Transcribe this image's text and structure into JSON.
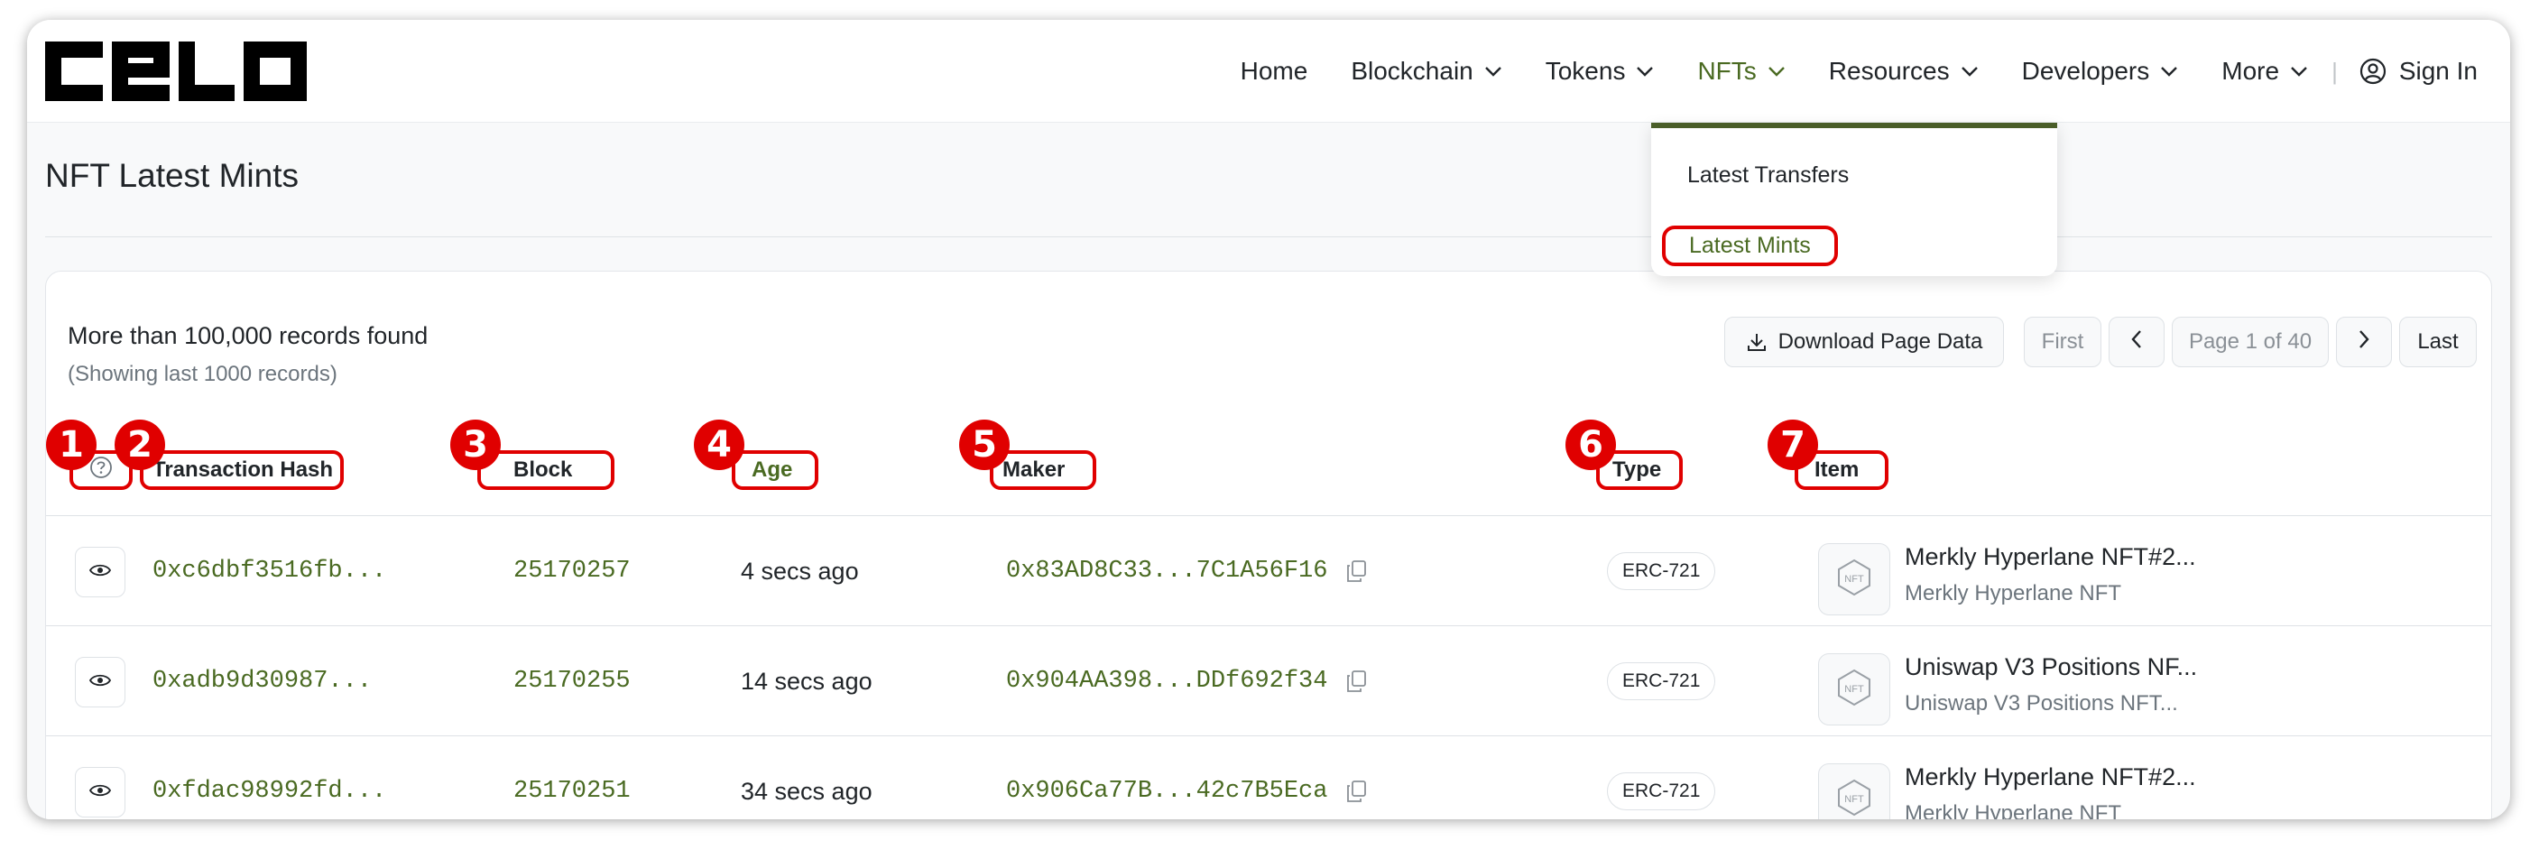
{
  "brand": {
    "logo_text": "CELO"
  },
  "nav": {
    "items": [
      {
        "label": "Home",
        "icon": ""
      },
      {
        "label": "Blockchain",
        "icon": "chevron-down-icon"
      },
      {
        "label": "Tokens",
        "icon": "chevron-down-icon"
      },
      {
        "label": "NFTs",
        "icon": "chevron-down-icon"
      },
      {
        "label": "Resources",
        "icon": "chevron-down-icon"
      },
      {
        "label": "Developers",
        "icon": "chevron-down-icon"
      },
      {
        "label": "More",
        "icon": "chevron-down-icon"
      }
    ],
    "signin": "Sign In"
  },
  "nft_dropdown": {
    "items": [
      "Latest Transfers",
      "Latest Mints"
    ],
    "active": "Latest Mints"
  },
  "page": {
    "title": "NFT Latest Mints"
  },
  "summary": {
    "records": "More than 100,000 records found",
    "sub": "(Showing last 1000 records)"
  },
  "toolbar": {
    "download": "Download Page Data",
    "first": "First",
    "page": "Page 1 of 40",
    "last": "Last"
  },
  "table": {
    "columns": [
      "Transaction Hash",
      "Block",
      "Age",
      "Maker",
      "Type",
      "Item"
    ],
    "annotations": [
      "1",
      "2",
      "3",
      "4",
      "5",
      "6",
      "7"
    ],
    "rows": [
      {
        "hash": "0xc6dbf3516fb...",
        "block": "25170257",
        "age": "4 secs ago",
        "maker": "0x83AD8C33...7C1A56F16",
        "type": "ERC-721",
        "item": "Merkly Hyperlane NFT#2...",
        "item_sub": "Merkly Hyperlane NFT"
      },
      {
        "hash": "0xadb9d30987...",
        "block": "25170255",
        "age": "14 secs ago",
        "maker": "0x904AA398...DDf692f34",
        "type": "ERC-721",
        "item": "Uniswap V3 Positions NF...",
        "item_sub": "Uniswap V3 Positions NFT..."
      },
      {
        "hash": "0xfdac98992fd...",
        "block": "25170251",
        "age": "34 secs ago",
        "maker": "0x906Ca77B...42c7B5Eca",
        "type": "ERC-721",
        "item": "Merkly Hyperlane NFT#2...",
        "item_sub": "Merkly Hyperlane NFT"
      }
    ]
  },
  "colors": {
    "accent": "#4a6a22",
    "annotation": "#e00000",
    "dropdown_border": "#4a5e29"
  }
}
